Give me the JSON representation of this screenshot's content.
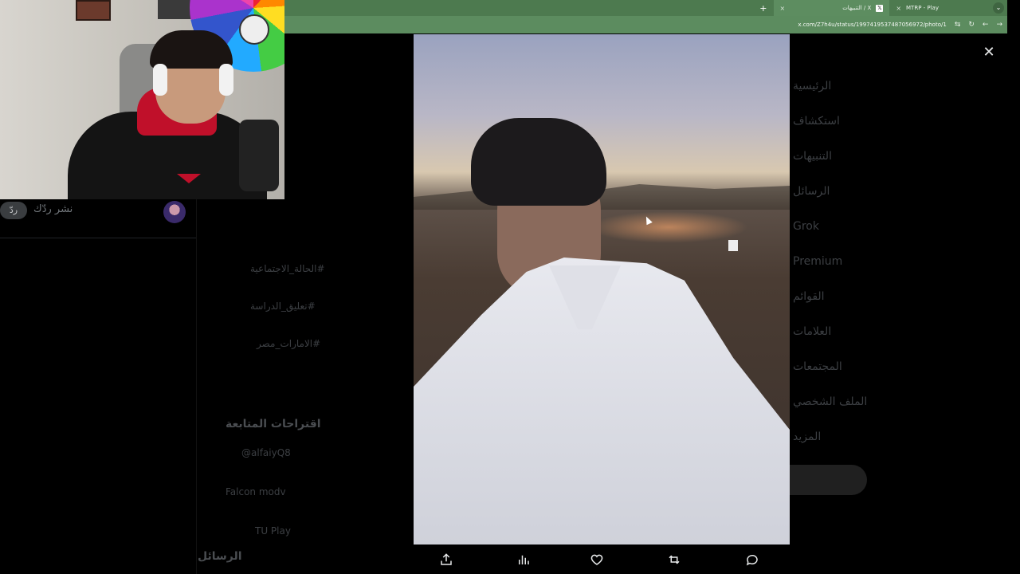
{
  "browser": {
    "tabs": [
      {
        "title": "MTRP - Play",
        "active": false
      },
      {
        "title": "التنبيهات / X",
        "active": true
      }
    ],
    "new_tab_label": "+",
    "close_label": "×",
    "url": "x.com/Z7h4u/status/1997419537487056972/photo/1"
  },
  "reply": {
    "button_label": "ردّ",
    "placeholder": "نشر ردّك"
  },
  "media_viewer": {
    "close_label": "✕",
    "actions": [
      "share",
      "views",
      "like",
      "repost",
      "reply"
    ]
  },
  "background_page": {
    "sidebar_items": [
      "الرئيسية",
      "استكشاف",
      "التنبيهات",
      "الرسائل",
      "Grok",
      "Premium",
      "القوائم",
      "العلامات",
      "المجتمعات",
      "الملف الشخصي",
      "المزيد"
    ],
    "trends": [
      "الحالة_الاجتماعية#",
      "تعليق_الدراسة#",
      "الامارات_مصر#"
    ],
    "follow_title": "اقتراحات المتابعة",
    "follow_accounts": [
      "@alfaiyQ8",
      "Falcon modv",
      "TU Play"
    ],
    "messages_label": "الرسائل"
  },
  "colors": {
    "tabstrip": "#4d7a4f",
    "addressbar": "#5c8c5f",
    "background": "#000000",
    "icon": "#e7e9ea"
  }
}
